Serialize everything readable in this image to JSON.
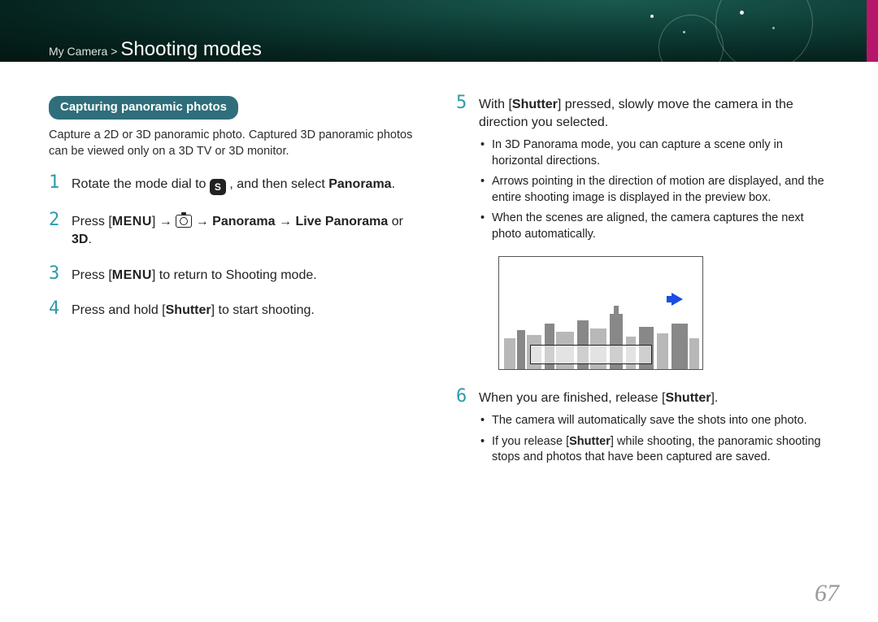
{
  "header": {
    "breadcrumb": "My Camera >",
    "title": "Shooting modes"
  },
  "section_pill": "Capturing panoramic photos",
  "intro": "Capture a 2D or 3D panoramic photo. Captured 3D panoramic photos can be viewed only on a 3D TV or 3D monitor.",
  "mode_icon_letter": "S",
  "steps_left": {
    "s1_a": "Rotate the mode dial to ",
    "s1_b": " , and then select ",
    "s1_c": "Panorama",
    "s1_d": ".",
    "s2_a": "Press [",
    "s2_menu": "MENU",
    "s2_b": "] → ",
    "s2_c": " → ",
    "s2_d": "Panorama",
    "s2_e": " → ",
    "s2_f": "Live Panorama",
    "s2_g": " or ",
    "s2_h": "3D",
    "s2_i": ".",
    "s3_a": "Press [",
    "s3_menu": "MENU",
    "s3_b": "] to return to Shooting mode.",
    "s4_a": "Press and hold [",
    "s4_b": "Shutter",
    "s4_c": "] to start shooting."
  },
  "steps_right": {
    "s5_a": "With [",
    "s5_b": "Shutter",
    "s5_c": "] pressed, slowly move the camera in the direction you selected.",
    "s5_bullets": [
      "In 3D Panorama mode, you can capture a scene only in horizontal directions.",
      "Arrows pointing in the direction of motion are displayed, and the entire shooting image is displayed in the preview box.",
      "When the scenes are aligned, the camera captures the next photo automatically."
    ],
    "s6_a": "When you are finished, release [",
    "s6_b": "Shutter",
    "s6_c": "].",
    "s6_bullets_a": "The camera will automatically save the shots into one photo.",
    "s6_bullets_b_1": "If you release [",
    "s6_bullets_b_2": "Shutter",
    "s6_bullets_b_3": "] while shooting, the panoramic shooting stops and photos that have been captured are saved."
  },
  "step_numbers": {
    "n1": "1",
    "n2": "2",
    "n3": "3",
    "n4": "4",
    "n5": "5",
    "n6": "6"
  },
  "page_number": "67"
}
